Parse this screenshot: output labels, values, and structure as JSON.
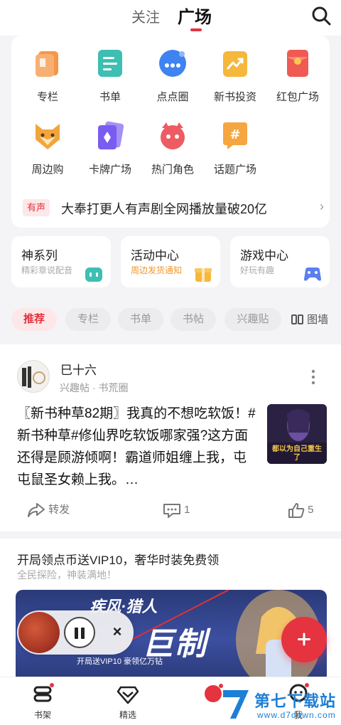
{
  "header": {
    "tabs": [
      {
        "label": "关注",
        "active": false
      },
      {
        "label": "广场",
        "active": true
      }
    ],
    "accent_color": "#e5333f"
  },
  "features": [
    {
      "label": "专栏",
      "icon": "column-icon",
      "color": "#f5974a"
    },
    {
      "label": "书单",
      "icon": "booklist-icon",
      "color": "#3dbfb2"
    },
    {
      "label": "点点圈",
      "icon": "circle-chat-icon",
      "color": "#3f83f1"
    },
    {
      "label": "新书投资",
      "icon": "invest-icon",
      "color": "#f5b83c"
    },
    {
      "label": "红包广场",
      "icon": "red-packet-icon",
      "color": "#ef5a52"
    },
    {
      "label": "周边购",
      "icon": "fox-icon",
      "color": "#f2a53b"
    },
    {
      "label": "卡牌广场",
      "icon": "cards-icon",
      "color": "#7a5cf0"
    },
    {
      "label": "热门角色",
      "icon": "character-icon",
      "color": "#ee5b63"
    },
    {
      "label": "话题广场",
      "icon": "topic-icon",
      "color": "#f5a640"
    }
  ],
  "news": {
    "badge": "有声",
    "text": "大奉打更人有声剧全网播放量破20亿",
    "arrow": "›"
  },
  "mini_cards": [
    {
      "title": "神系列",
      "subtitle": "精彩章说配音",
      "sub_color": "#aaaaaa",
      "icon": "robot-icon",
      "icon_color": "#3dbfb2"
    },
    {
      "title": "活动中心",
      "subtitle": "周边发货通知",
      "sub_color": "#f3962a",
      "icon": "gift-icon",
      "icon_color": "#f5b83c"
    },
    {
      "title": "游戏中心",
      "subtitle": "好玩有趣",
      "sub_color": "#aaaaaa",
      "icon": "gamepad-icon",
      "icon_color": "#5b7ef0"
    }
  ],
  "chips": [
    {
      "label": "推荐",
      "active": true
    },
    {
      "label": "专栏",
      "active": false
    },
    {
      "label": "书单",
      "active": false
    },
    {
      "label": "书帖",
      "active": false
    },
    {
      "label": "兴趣贴",
      "active": false
    }
  ],
  "view_toggle": "图墙",
  "post": {
    "author": "巳十六",
    "meta": "兴趣帖 · 书荒圈",
    "text": "〖新书种草82期〗我真的不想吃软饭！#新书种草#修仙界吃软饭哪家强?这方面还得是顾游倾啊！霸道师姐缠上我，屯屯鼠圣女赖上我。…",
    "thumb_text": "都以为自己重生了",
    "actions": {
      "share_label": "转发",
      "comments": "1",
      "likes": "5"
    }
  },
  "promo": {
    "title": "开局领点币送VIP10，奢华时装免费领",
    "subtitle": "全民探险，神装满地！",
    "banner_logo": "疾风·猎人",
    "banner_big": "巨制",
    "banner_small": "开局送VIP10 豪领亿万钻"
  },
  "bottom_nav": [
    {
      "label": "书架",
      "icon": "bookshelf-icon",
      "dot": true
    },
    {
      "label": "精选",
      "icon": "diamond-icon",
      "dot": false
    },
    {
      "label": "",
      "icon": "community-icon",
      "dot": true
    },
    {
      "label": "我",
      "icon": "profile-icon",
      "dot": true
    }
  ],
  "watermark": {
    "text": "第七下载站",
    "url": "www.d7down.com"
  }
}
